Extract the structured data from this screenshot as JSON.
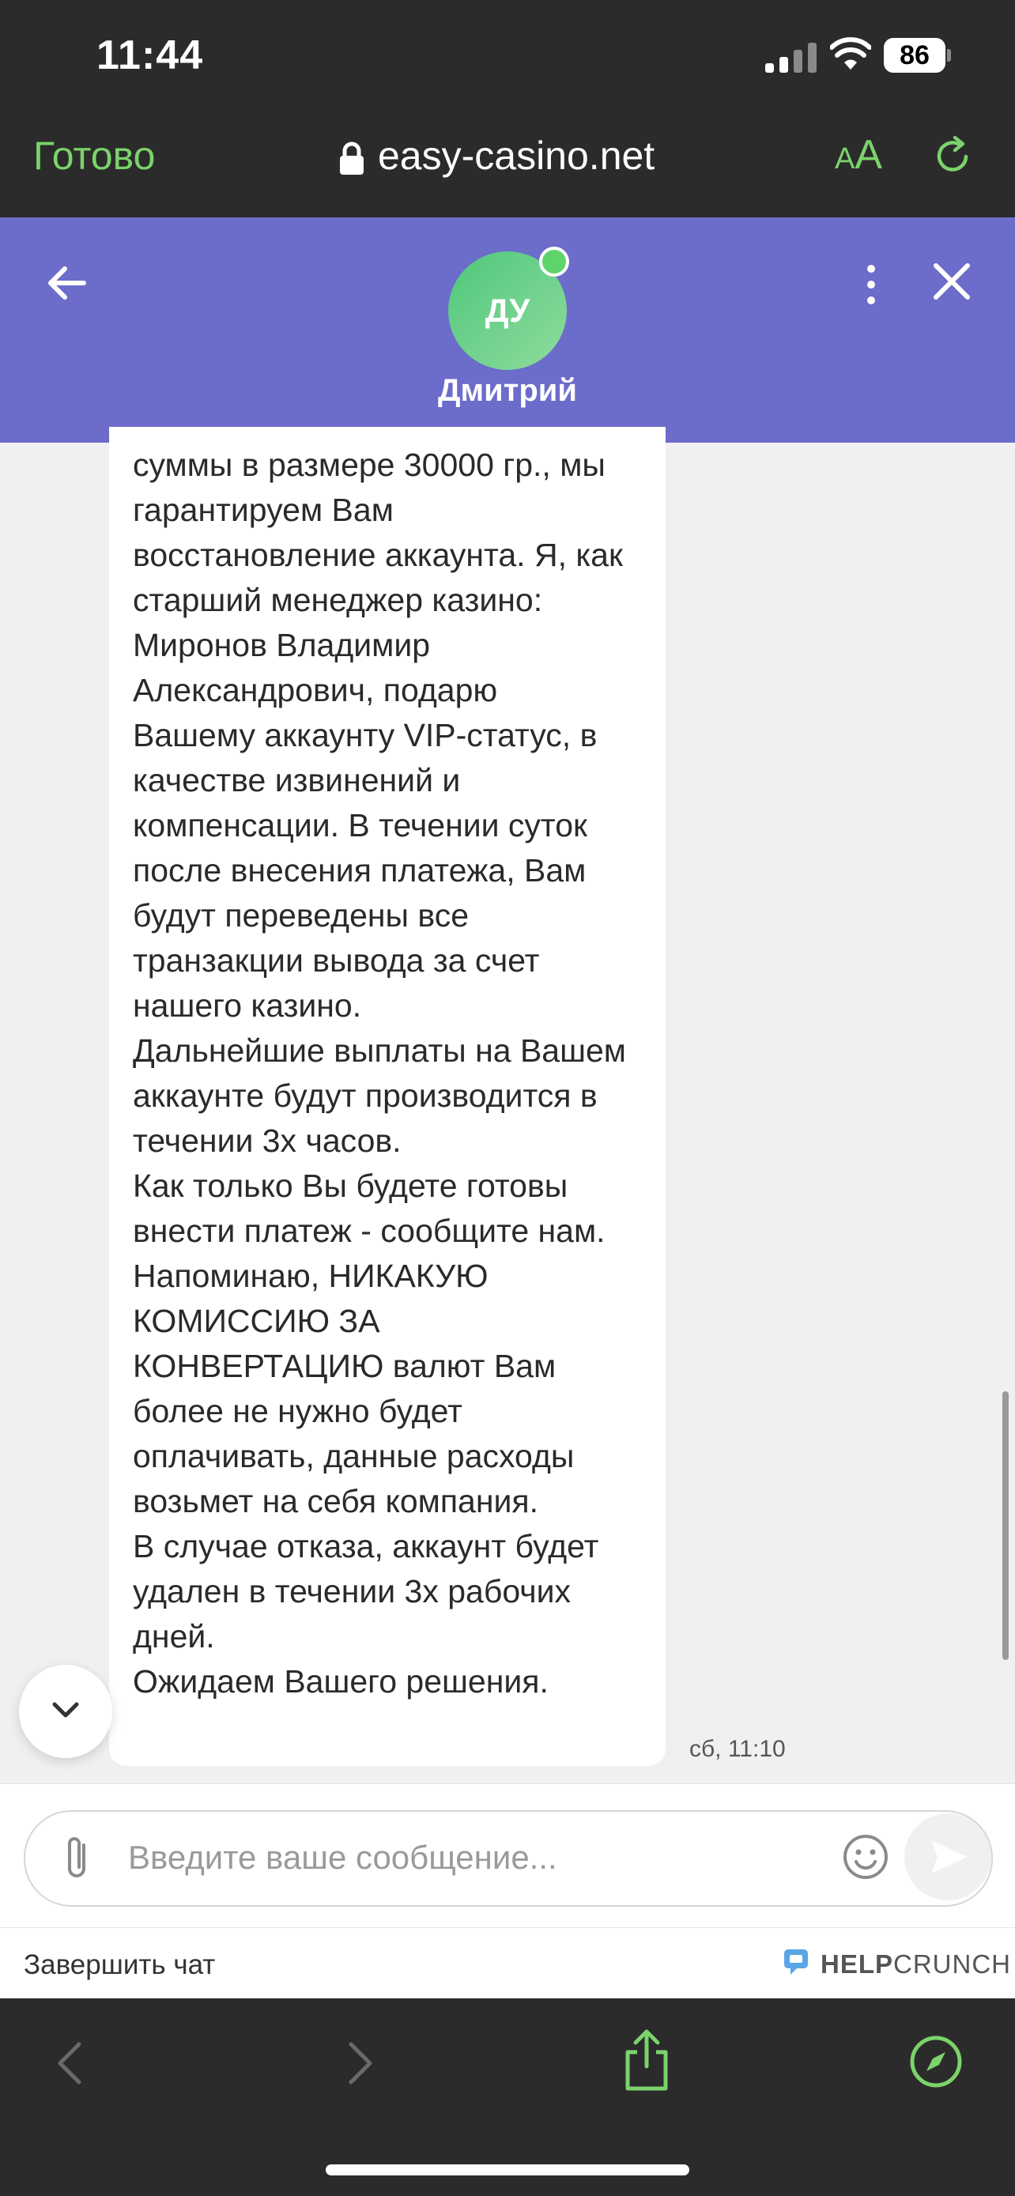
{
  "status_bar": {
    "time": "11:44",
    "battery": "86"
  },
  "browser": {
    "done_label": "Готово",
    "url": "easy-casino.net",
    "aa_small": "A",
    "aa_big": "A"
  },
  "chat": {
    "agent_initials": "ДУ",
    "agent_name": "Дмитрий",
    "message_text": "суммы в размере 30000 гр., мы\nгарантируем Вам\nвосстановление аккаунта. Я, как\nстарший менеджер казино:\nМиронов Владимир\nАлександрович, подарю\nВашему аккаунту VIP-статус, в\nкачестве извинений и\nкомпенсации. В течении суток\nпосле внесения платежа, Вам\nбудут переведены все\nтранзакции вывода за счет\nнашего казино.\nДальнейшие выплаты на Вашем\nаккаунте будут производится в\nтечении 3х часов.\nКак только Вы будете готовы\nвнести платеж - сообщите нам.\nНапоминаю, НИКАКУЮ\nКОМИССИЮ ЗА\nКОНВЕРТАЦИЮ валют Вам\nболее не нужно будет\nоплачивать, данные расходы\nвозьмет на себя компания.\nВ случае отказа, аккаунт будет\nудален в течении 3х рабочих\nдней.\nОжидаем Вашего решения.",
    "message_time": "сб, 11:10",
    "input_placeholder": "Введите ваше сообщение...",
    "input_value": ""
  },
  "footer": {
    "end_chat_label": "Завершить чат",
    "brand_bold": "HELP",
    "brand_rest": "CRUNCH"
  },
  "colors": {
    "header_bg": "#6c6ccb",
    "accent_green": "#7bd36b",
    "chrome_bg": "#2b2b2b"
  },
  "icons": [
    "signal-icon",
    "wifi-icon",
    "lock-icon",
    "reload-icon",
    "back-arrow-icon",
    "more-icon",
    "close-icon",
    "chevron-down-icon",
    "paperclip-icon",
    "emoji-icon",
    "send-icon",
    "helpcrunch-logo-icon",
    "nav-back-icon",
    "nav-forward-icon",
    "share-icon",
    "compass-icon"
  ]
}
